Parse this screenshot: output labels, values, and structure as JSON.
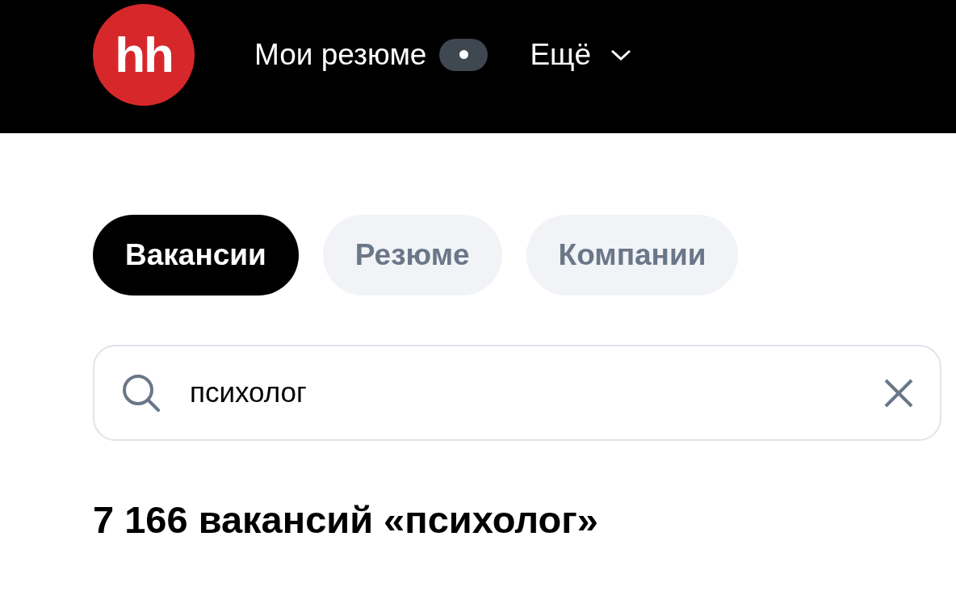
{
  "header": {
    "logo": "hh",
    "nav": [
      {
        "label": "Мои резюме",
        "kind": "badge"
      },
      {
        "label": "Ещё",
        "kind": "dropdown"
      }
    ]
  },
  "search_tabs": [
    {
      "label": "Вакансии",
      "selected": true
    },
    {
      "label": "Резюме",
      "selected": false
    },
    {
      "label": "Компании",
      "selected": false
    }
  ],
  "search": {
    "value": "психолог"
  },
  "results_heading": "7 166 вакансий «психолог»"
}
